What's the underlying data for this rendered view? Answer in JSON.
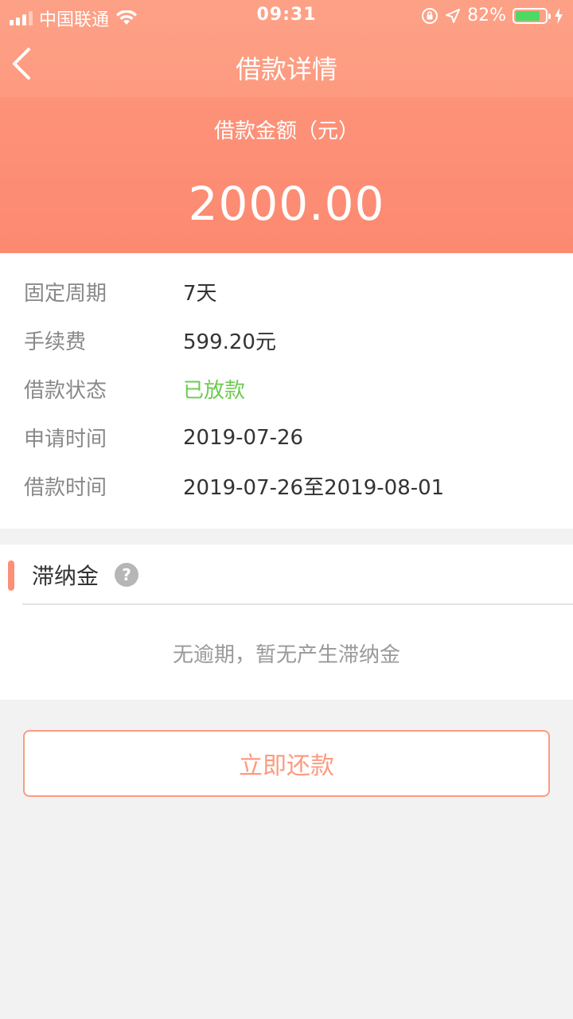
{
  "status_bar": {
    "carrier": "中国联通",
    "time": "09:31",
    "battery": "82%",
    "battery_level": 0.82
  },
  "nav": {
    "title": "借款详情"
  },
  "amount": {
    "label": "借款金额（元）",
    "value": "2000.00"
  },
  "details": [
    {
      "label": "固定周期",
      "value": "7天"
    },
    {
      "label": "手续费",
      "value": "599.20元"
    },
    {
      "label": "借款状态",
      "value": "已放款"
    },
    {
      "label": "申请时间",
      "value": "2019-07-26"
    },
    {
      "label": "借款时间",
      "value": "2019-07-26至2019-08-01"
    }
  ],
  "late_fee": {
    "title": "滞纳金",
    "help": "?",
    "empty_text": "无逾期，暂无产生滞纳金"
  },
  "actions": {
    "repay_label": "立即还款"
  },
  "colors": {
    "accent": "#fd9a80",
    "status_green": "#6bcb4f"
  }
}
